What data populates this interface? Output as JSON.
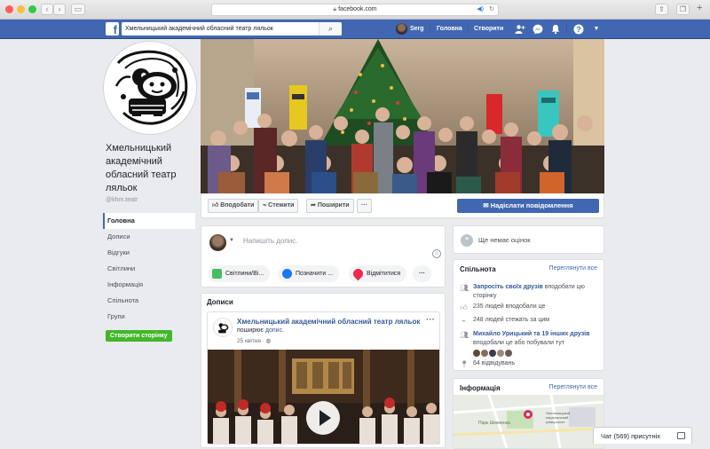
{
  "browser": {
    "url": "facebook.com"
  },
  "topbar": {
    "search_value": "Хмельницький академічний обласний театр ляльок",
    "user_name": "Serg",
    "home_label": "Головна",
    "create_label": "Створити"
  },
  "page": {
    "name": "Хмельницький академічний обласний театр ляльок",
    "handle": "@khm.teatr"
  },
  "left_nav": [
    {
      "label": "Головна",
      "active": true
    },
    {
      "label": "Дописи"
    },
    {
      "label": "Відгуки"
    },
    {
      "label": "Світлини"
    },
    {
      "label": "Інформація"
    },
    {
      "label": "Спільнота"
    },
    {
      "label": "Групи"
    }
  ],
  "create_page_label": "Створити сторінку",
  "actions": {
    "like": "Вподобати",
    "follow": "Стежити",
    "share": "Поширити",
    "more": "···",
    "message": "Надіслати повідомлення"
  },
  "composer": {
    "placeholder": "Напишіть допис.",
    "chips": [
      {
        "label": "Світлини/Ві...",
        "color": "#45bd62"
      },
      {
        "label": "Позначити ...",
        "color": "#1877f2"
      },
      {
        "label": "Відмітитися",
        "color": "#f02849"
      }
    ],
    "more": "···"
  },
  "posts_section": {
    "title": "Дописи"
  },
  "post": {
    "author": "Хмельницький академічний обласний театр ляльок",
    "action_prefix": "поширює",
    "action_link": "допис.",
    "date": "25 квітня ·",
    "more": "···"
  },
  "ratings": {
    "text": "Ще немає оцінок"
  },
  "community": {
    "title": "Спільнота",
    "see_all": "Переглянути все",
    "invite_link": "Запросіть своїх друзів",
    "invite_rest": "вподобати цю сторінку",
    "likes": "235 людей вподобали це",
    "follows": "248 людей стежать за цим",
    "friends_link": "Михайло Урицький та 19 інших друзів",
    "friends_rest": "вподобали це або побували тут",
    "visits": "64 відвідувань"
  },
  "info": {
    "title": "Інформація",
    "see_all": "Переглянути все",
    "map_label_1": "Парк Шевченка",
    "map_label_2": "Хмельницький національний університет"
  },
  "chat": {
    "label": "Чат (569) присутніх"
  }
}
